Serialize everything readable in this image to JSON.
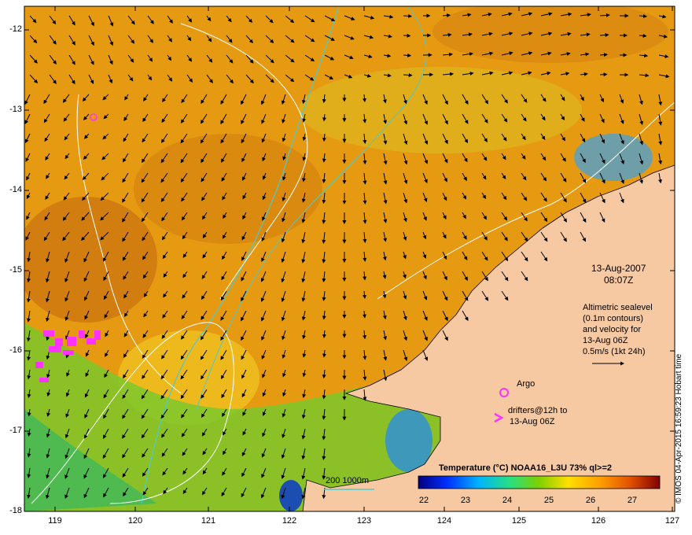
{
  "map": {
    "lat_labels": [
      "-12",
      "-13",
      "-14",
      "-15",
      "-16",
      "-17",
      "-18"
    ],
    "lon_labels": [
      "119",
      "120",
      "121",
      "122",
      "123",
      "124",
      "125",
      "126",
      "127"
    ],
    "colors": {
      "land": "#f7c9a3",
      "sst_warm": "#e08a10",
      "sst_cool": "#3fb85a",
      "argo": "#ff33ff",
      "contour": "#ffffff",
      "isobath": "#4fc9c9"
    }
  },
  "annotation": {
    "date": "13-Aug-2007",
    "time": "08:07Z",
    "alt_line1": "Altimetric sealevel",
    "alt_line2": "(0.1m contours)",
    "alt_line3": "and velocity for",
    "alt_line4": "13-Aug 06Z",
    "speed": "0.5m/s (1kt 24h)"
  },
  "legend": {
    "argo": "Argo",
    "drifters_line1": "drifters@12h to",
    "drifters_line2": "13-Aug 06Z",
    "isobath": "200  1000m",
    "colorbar_title": "Temperature (°C) NOAA16_L3U 73% ql>=2",
    "colorbar_ticks": [
      "22",
      "23",
      "24",
      "25",
      "26",
      "27"
    ]
  },
  "credit": "© IMOS 04-Apr-2015 16:59:23 Hobart time"
}
